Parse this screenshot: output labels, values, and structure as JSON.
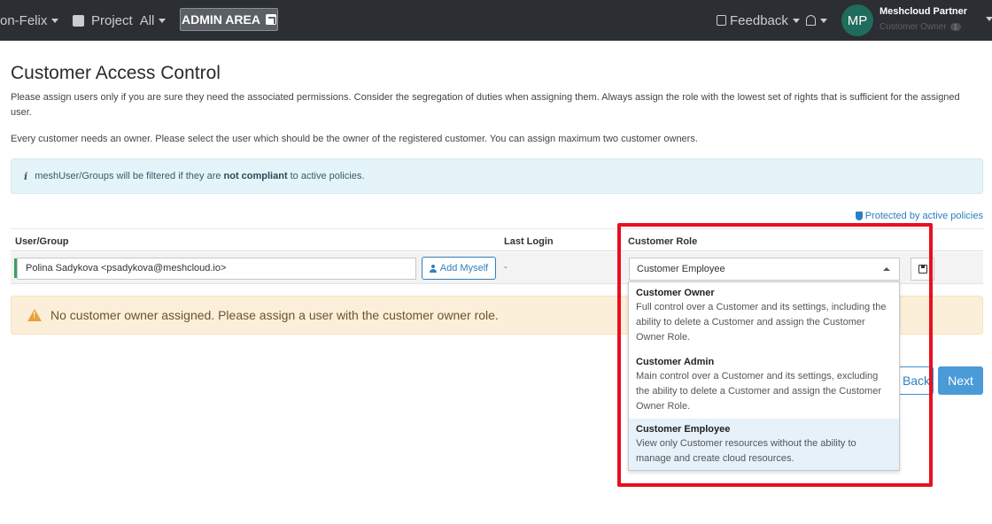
{
  "navbar": {
    "workspace": "on-Felix",
    "project": "Project",
    "project_value": "All",
    "admin_area": "ADMIN AREA",
    "feedback": "Feedback",
    "avatar_initials": "MP",
    "partner_name": "Meshcloud Partner",
    "partner_role": "Customer Owner",
    "partner_role_badge": "1"
  },
  "page": {
    "title": "Customer Access Control",
    "intro": "Please assign users only if you are sure they need the associated permissions. Consider the segregation of duties when assigning them. Always assign the role with the lowest set of rights that is sufficient for the assigned user.",
    "owner_info": "Every customer needs an owner. Please select the user which should be the owner of the registered customer. You can assign maximum two customer owners.",
    "info_alert_pre": "meshUser/Groups will be filtered if they are",
    "info_alert_bold": "not compliant",
    "info_alert_post": "to active policies.",
    "protected_link": "Protected by active policies"
  },
  "table": {
    "headers": [
      "User/Group",
      "Last Login",
      "Customer Role"
    ],
    "row": {
      "user": "Polina Sadykova <psadykova@meshcloud.io>",
      "add_myself": "Add Myself",
      "last_login": "-",
      "role": "Customer Employee"
    }
  },
  "warning": "No customer owner assigned. Please assign a user with the customer owner role.",
  "buttons": {
    "back": "Back",
    "next": "Next"
  },
  "dropdown": {
    "options": [
      {
        "title": "Customer Owner",
        "desc": "Full control over a Customer and its settings, including the ability to delete a Customer and assign the Customer Owner Role."
      },
      {
        "title": "Customer Admin",
        "desc": "Main control over a Customer and its settings, excluding the ability to delete a Customer and assign the Customer Owner Role."
      },
      {
        "title": "Customer Employee",
        "desc": "View only Customer resources without the ability to manage and create cloud resources."
      }
    ]
  },
  "colors": {
    "highlight": "#e8101e",
    "primary": "#4a9ad8",
    "navbar": "#2b2e32"
  }
}
